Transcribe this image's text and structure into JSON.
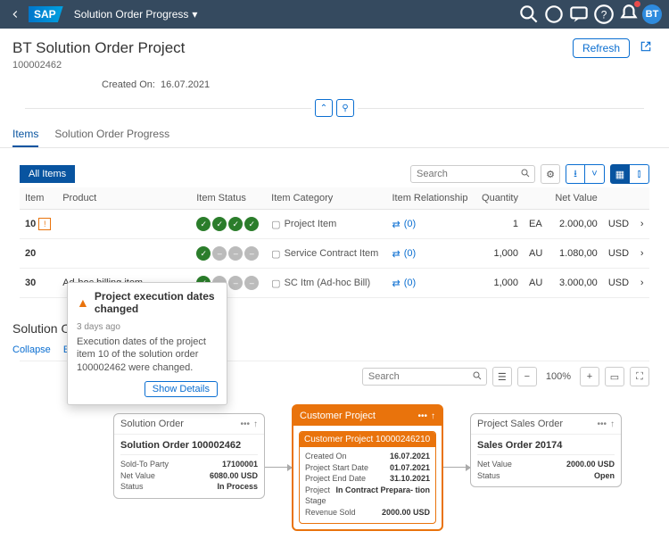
{
  "shell": {
    "title": "Solution Order Progress",
    "avatar": "BT",
    "notif_count": 1
  },
  "header": {
    "title": "BT Solution Order Project",
    "id": "100002462",
    "created_label": "Created On:",
    "created_value": "16.07.2021",
    "refresh": "Refresh"
  },
  "tabs": {
    "items": "Items",
    "progress": "Solution Order Progress"
  },
  "toolbar": {
    "all": "All Items",
    "search_ph": "Search"
  },
  "cols": {
    "item": "Item",
    "product": "Product",
    "istatus": "Item Status",
    "icat": "Item Category",
    "irel": "Item Relationship",
    "qty": "Quantity",
    "unit": "",
    "netval": "Net Value",
    "curr": ""
  },
  "rows": [
    {
      "item": "10",
      "warn": true,
      "product": "",
      "status": [
        "g",
        "g",
        "g",
        "g"
      ],
      "cat": "Project Item",
      "rel": "(0)",
      "qty": "1",
      "unit": "EA",
      "val": "2.000,00",
      "curr": "USD"
    },
    {
      "item": "20",
      "warn": false,
      "product": "",
      "status": [
        "g",
        "x",
        "x",
        "x"
      ],
      "cat": "Service Contract Item",
      "rel": "(0)",
      "qty": "1,000",
      "unit": "AU",
      "val": "1.080,00",
      "curr": "USD"
    },
    {
      "item": "30",
      "warn": false,
      "product": "Ad-hoc billing item",
      "status": [
        "g",
        "x",
        "x",
        "x"
      ],
      "cat": "SC Itm (Ad-hoc Bill)",
      "rel": "(0)",
      "qty": "1,000",
      "unit": "AU",
      "val": "3.000,00",
      "curr": "USD"
    }
  ],
  "popover": {
    "title": "Project execution dates changed",
    "time": "3 days ago",
    "body": "Execution dates of the project item 10 of the solution order 100002462 were changed.",
    "action": "Show Details"
  },
  "progress": {
    "title": "Solution Order Progress",
    "collapse": "Collapse",
    "expand": "Expand",
    "search_ph": "Search",
    "zoom": "100%",
    "solution": {
      "header": "Solution Order",
      "title": "Solution Order 100002462",
      "rows": [
        [
          "Sold-To Party",
          "17100001"
        ],
        [
          "Net Value",
          "6080.00 USD"
        ],
        [
          "Status",
          "In Process"
        ]
      ]
    },
    "project": {
      "header": "Customer Project",
      "title": "Customer Project 10000246210",
      "rows": [
        [
          "Created On",
          "16.07.2021"
        ],
        [
          "Project Start Date",
          "01.07.2021"
        ],
        [
          "Project End Date",
          "31.10.2021"
        ],
        [
          "Project Stage",
          "In Contract Prepara- tion"
        ],
        [
          "Revenue Sold",
          "2000.00 USD"
        ]
      ]
    },
    "sales": {
      "header": "Project Sales Order",
      "title": "Sales Order 20174",
      "rows": [
        [
          "Net Value",
          "2000.00 USD"
        ],
        [
          "Status",
          "Open"
        ]
      ]
    }
  }
}
